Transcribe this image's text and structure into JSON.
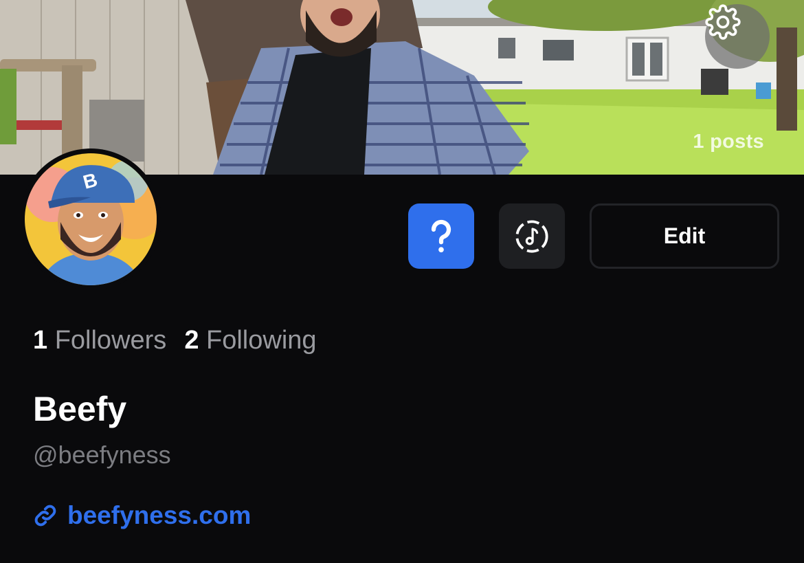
{
  "profile": {
    "posts_count": "1 posts",
    "followers_count": "1",
    "followers_label": "Followers",
    "following_count": "2",
    "following_label": "Following",
    "display_name": "Beefy",
    "handle": "@beefyness",
    "website": "beefyness.com"
  },
  "actions": {
    "help_icon": "question-mark-icon",
    "music_icon": "music-note-icon",
    "edit_label": "Edit",
    "settings_icon": "gear-icon"
  },
  "colors": {
    "background": "#0a0a0c",
    "accent": "#2f6fec",
    "muted_text": "#9a9ba0",
    "secondary_button": "#1e1f22"
  }
}
